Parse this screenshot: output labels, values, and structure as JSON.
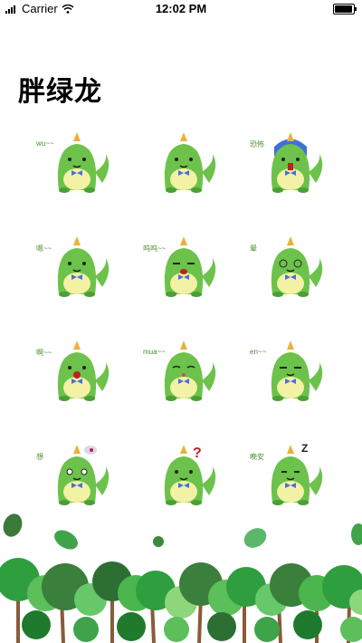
{
  "status_bar": {
    "carrier": "Carrier",
    "time": "12:02 PM",
    "icons": [
      "signal-icon",
      "wifi-icon",
      "battery-icon"
    ]
  },
  "page": {
    "title": "胖绿龙"
  },
  "stickers": [
    {
      "label": "wu~~",
      "face": "wu"
    },
    {
      "label": "",
      "face": "happy"
    },
    {
      "label": "恐怖",
      "face": "scared"
    },
    {
      "label": "嗯~~",
      "face": "hmm"
    },
    {
      "label": "呜呜~~",
      "face": "cry"
    },
    {
      "label": "晕",
      "face": "dizzy"
    },
    {
      "label": "啊~~",
      "face": "shock"
    },
    {
      "label": "mua~~",
      "face": "kiss"
    },
    {
      "label": "en~~",
      "face": "en"
    },
    {
      "label": "想",
      "face": "think"
    },
    {
      "label": "",
      "face": "question"
    },
    {
      "label": "晚安",
      "face": "sleep"
    }
  ],
  "colors": {
    "dragon_green": "#6cc24a",
    "belly": "#f3f1a5",
    "horn": "#e8b23a",
    "bowtie": "#4a6fd6"
  }
}
